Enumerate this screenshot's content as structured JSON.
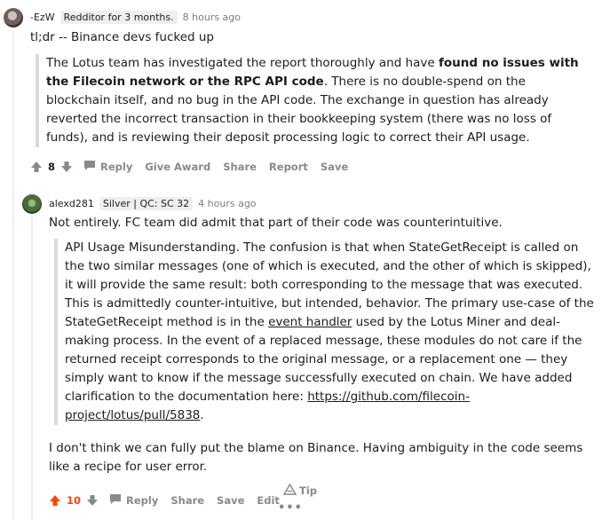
{
  "comment1": {
    "username": "-EzW",
    "flair": "Redditor for 3 months.",
    "time": "8 hours ago",
    "text": "tl;dr -- Binance devs fucked up",
    "quote": {
      "p1": "The Lotus team has investigated the report thoroughly and have ",
      "bold": "found no issues with the Filecoin network or the RPC API code",
      "p2": ". There is no double-spend on the blockchain itself, and no bug in the API code. The exchange in question has already reverted the incorrect transaction in their bookkeeping system (there was no loss of funds), and is reviewing their deposit processing logic to correct their API usage."
    },
    "votes": "8",
    "actions": {
      "reply": "Reply",
      "give_award": "Give Award",
      "share": "Share",
      "report": "Report",
      "save": "Save"
    }
  },
  "comment2": {
    "username": "alexd281",
    "flair": "Silver | QC: SC 32",
    "time": "4 hours ago",
    "text": "Not entirely. FC team did admit that part of their code was counterintuitive.",
    "quote": {
      "p1": "API Usage Misunderstanding. The confusion is that when StateGetReceipt is called on the two similar messages (one of which is executed, and the other of which is skipped), it will provide the same result: both corresponding to the message that was executed. This is admittedly counter-intuitive, but intended, behavior. The primary use-case of the StateGetReceipt method is in the ",
      "link1": "event handler",
      "p2": " used by the Lotus Miner and deal-making process. In the event of a replaced message, these modules do not care if the returned receipt corresponds to the original message, or a replacement one — they simply want to know if the message successfully executed on chain. We have added clarification to the documentation here: ",
      "link2": "https://github.com/filecoin-project/lotus/pull/5838",
      "p3": "."
    },
    "text2": "I don't think we can fully put the blame on Binance. Having ambiguity in the code seems like a recipe for user error.",
    "votes": "10",
    "actions": {
      "reply": "Reply",
      "share": "Share",
      "save": "Save",
      "edit": "Edit",
      "tip": "Tip",
      "more": "•••"
    }
  },
  "colors": {
    "upvote_active": "#ff4500",
    "action_gray": "#878a8c",
    "quote_border": "#d7dadc"
  },
  "icons": {
    "upvote": "arrow-up-icon",
    "downvote": "arrow-down-icon",
    "reply": "comment-bubble-icon",
    "tip": "triangle-tip-icon"
  }
}
